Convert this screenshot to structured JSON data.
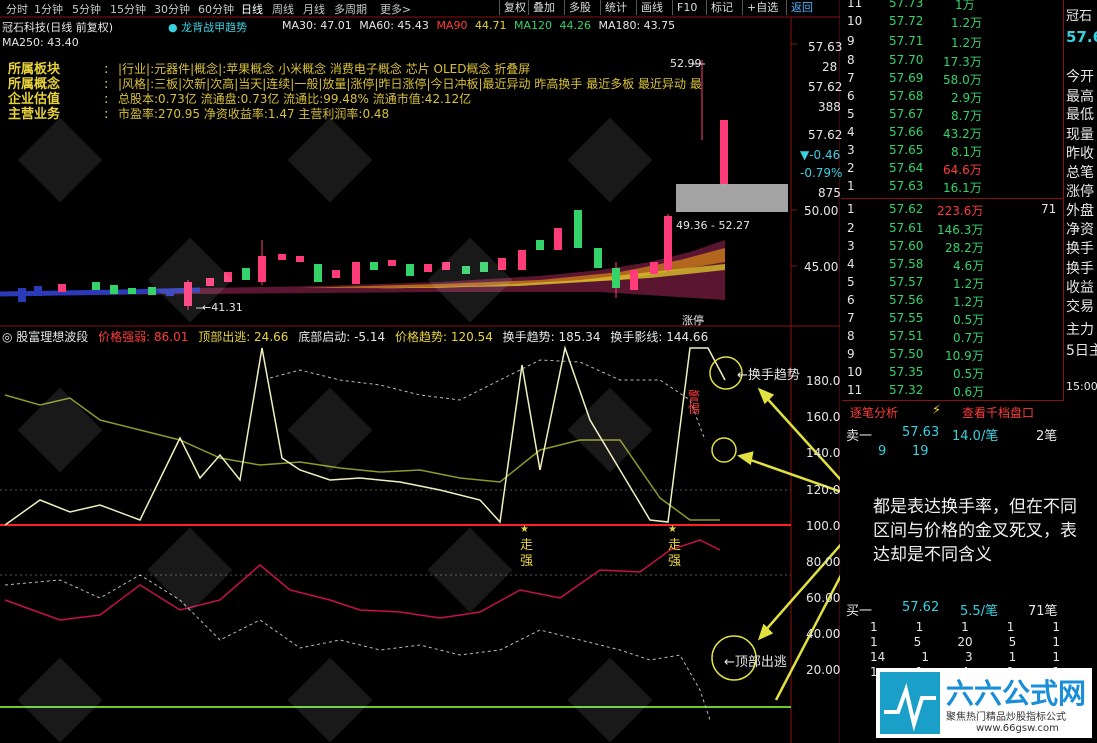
{
  "toolbar": {
    "periods": [
      "分时",
      "1分钟",
      "5分钟",
      "15分钟",
      "30分钟",
      "60分钟",
      "日线",
      "周线",
      "月线",
      "多周期",
      "更多>"
    ],
    "buttons": [
      "复权",
      "叠加",
      "多股",
      "统计",
      "画线",
      "F10",
      "标记",
      "+自选",
      "返回"
    ]
  },
  "stock": {
    "title": "冠石科技(日线 前复权)",
    "indicator_name": "龙背战甲趋势",
    "ma_labels": [
      {
        "text": "MA30: 47.01",
        "color": "#e6e6e6"
      },
      {
        "text": "MA60: 45.43",
        "color": "#e6e6e6"
      },
      {
        "text": "MA90",
        "color": "#ff3b3b"
      },
      {
        "text": "44.71",
        "color": "#e8d33a"
      },
      {
        "text": "MA120",
        "color": "#33d36a"
      },
      {
        "text": "44.26",
        "color": "#33d36a"
      },
      {
        "text": "MA180: 43.75",
        "color": "#e6e6e6"
      }
    ],
    "ma250": "MA250: 43.40"
  },
  "info_block": {
    "labels": [
      "所属板块",
      "所属概念",
      "企业估值",
      "主营业务"
    ],
    "lines": [
      "|行业|:元器件|概念|:苹果概念 小米概念 消费电子概念 芯片 OLED概念 折叠屏",
      "|风格|:三板|次新|次高|当天|连续|一般|放量|涨停|昨日涨停|今日冲板|最近异动 昨高换手 最近多板 最近异动 最",
      "总股本:0.73亿 流通盘:0.73亿 流通比:99.48% 流通市值:42.12亿",
      "市盈率:270.95 净资收益率:1.47 主营利润率:0.48"
    ]
  },
  "price_axis": {
    "labels": [
      "57.63",
      "28",
      "57.62",
      "388",
      "57.62",
      "▼-0.46",
      "-0.79%",
      "875",
      "50.00",
      "45.00"
    ],
    "high_mark": "52.99",
    "low_mark": "41.31",
    "range_box": "49.36 - 52.27"
  },
  "osc": {
    "title": "股富理想波段",
    "items": [
      {
        "text": "价格强弱: 86.01",
        "color": "#ff3b3b"
      },
      {
        "text": "顶部出逃: 24.66",
        "color": "#e8d33a"
      },
      {
        "text": "底部启动: -5.14",
        "color": "#e6e6e6"
      },
      {
        "text": "价格趋势: 120.54",
        "color": "#e8d33a"
      },
      {
        "text": "换手趋势: 185.34",
        "color": "#e6e6e6"
      },
      {
        "text": "换手影线: 144.66",
        "color": "#e6e6e6"
      }
    ],
    "y_labels": [
      "180.0",
      "160.0",
      "140.0",
      "120.0",
      "100.0",
      "80.00",
      "60.00",
      "40.00",
      "20.00"
    ],
    "signals": [
      "走强",
      "走强"
    ],
    "annot_huanshou": "换手趋势",
    "annot_dingbu": "顶部出逃",
    "annot_pocket": "涨停",
    "annot_red": "警惕"
  },
  "callout": "都是表达换手率，但在不同区间与价格的金叉死叉，表达却是不同含义",
  "sell_book": [
    {
      "n": "11",
      "p": "57.73",
      "v": "1万",
      "c": "green"
    },
    {
      "n": "10",
      "p": "57.72",
      "v": "1.2万",
      "c": "green"
    },
    {
      "n": "9",
      "p": "57.71",
      "v": "1.2万",
      "c": "green"
    },
    {
      "n": "8",
      "p": "57.70",
      "v": "17.3万",
      "c": "green"
    },
    {
      "n": "7",
      "p": "57.69",
      "v": "58.0万",
      "c": "green"
    },
    {
      "n": "6",
      "p": "57.68",
      "v": "2.9万",
      "c": "green"
    },
    {
      "n": "5",
      "p": "57.67",
      "v": "8.7万",
      "c": "green"
    },
    {
      "n": "4",
      "p": "57.66",
      "v": "43.2万",
      "c": "green"
    },
    {
      "n": "3",
      "p": "57.65",
      "v": "8.1万",
      "c": "green"
    },
    {
      "n": "2",
      "p": "57.64",
      "v": "64.6万",
      "c": "red"
    },
    {
      "n": "1",
      "p": "57.63",
      "v": "16.1万",
      "c": "green"
    }
  ],
  "buy_book": [
    {
      "n": "1",
      "p": "57.62",
      "v": "223.6万",
      "c": "red"
    },
    {
      "n": "2",
      "p": "57.61",
      "v": "146.3万",
      "c": "green"
    },
    {
      "n": "3",
      "p": "57.60",
      "v": "28.2万",
      "c": "green"
    },
    {
      "n": "4",
      "p": "57.58",
      "v": "4.6万",
      "c": "green"
    },
    {
      "n": "5",
      "p": "57.57",
      "v": "1.2万",
      "c": "green"
    },
    {
      "n": "6",
      "p": "57.56",
      "v": "1.2万",
      "c": "green"
    },
    {
      "n": "7",
      "p": "57.55",
      "v": "0.5万",
      "c": "green"
    },
    {
      "n": "8",
      "p": "57.51",
      "v": "0.7万",
      "c": "green"
    },
    {
      "n": "9",
      "p": "57.50",
      "v": "10.9万",
      "c": "green"
    },
    {
      "n": "10",
      "p": "57.35",
      "v": "0.5万",
      "c": "green"
    },
    {
      "n": "11",
      "p": "57.32",
      "v": "0.6万",
      "c": "green"
    }
  ],
  "buy_right": [
    "71",
    "",
    "",
    "",
    "",
    "",
    "",
    "",
    "",
    "",
    ""
  ],
  "right_panel": {
    "name": "冠石",
    "price": "57.6",
    "labels": [
      "今开",
      "最高",
      "最低",
      "现量",
      "昨收",
      "总笔",
      "涨停",
      "外盘",
      "净资",
      "换手",
      "换手",
      "收益",
      "交易",
      "主力",
      "5日主"
    ],
    "time": "15:00"
  },
  "tick_header": {
    "tab1": "逐笔分析",
    "tab2": "查看千档盘口"
  },
  "sell1_row": {
    "label": "卖一",
    "price": "57.63",
    "vol": "14.0/笔",
    "cnt": "2笔",
    "sub1": "9",
    "sub2": "19"
  },
  "buy1_row": {
    "label": "买一",
    "price": "57.62",
    "vol": "5.5/笔",
    "cnt": "71笔"
  },
  "queue": [
    [
      "1",
      "1",
      "1",
      "1",
      "1"
    ],
    [
      "1",
      "5",
      "20",
      "5",
      "1"
    ],
    [
      "14",
      "1",
      "3",
      "1",
      "1"
    ],
    [
      "1",
      "1",
      "4",
      "1",
      "1"
    ]
  ],
  "watermark": {
    "title": "六六公式网",
    "subtitle": "聚焦热门精品炒股指标公式",
    "url": "www.66gsw.com"
  }
}
